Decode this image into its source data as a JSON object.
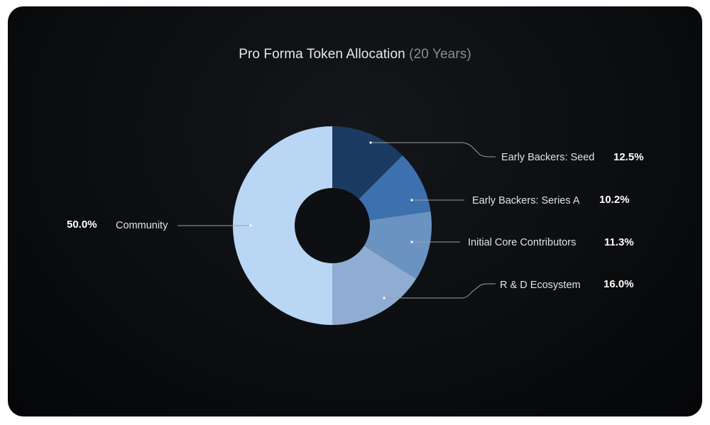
{
  "chart_data": {
    "type": "pie",
    "variant": "donut",
    "title": "Pro Forma Token Allocation",
    "subtitle": "(20 Years)",
    "start_angle_deg": 0,
    "direction": "clockwise",
    "slices": [
      {
        "label": "Early Backers: Seed",
        "value": 12.5,
        "value_label": "12.5%",
        "color": "#1b3b63"
      },
      {
        "label": "Early Backers: Series A",
        "value": 10.2,
        "value_label": "10.2%",
        "color": "#3d70af"
      },
      {
        "label": "Initial Core Contributors",
        "value": 11.3,
        "value_label": "11.3%",
        "color": "#6a93c1"
      },
      {
        "label": "R & D Ecosystem",
        "value": 16.0,
        "value_label": "16.0%",
        "color": "#8fadd2"
      },
      {
        "label": "Community",
        "value": 50.0,
        "value_label": "50.0%",
        "color": "#b9d6f5"
      }
    ],
    "legend": "leader-lines"
  }
}
